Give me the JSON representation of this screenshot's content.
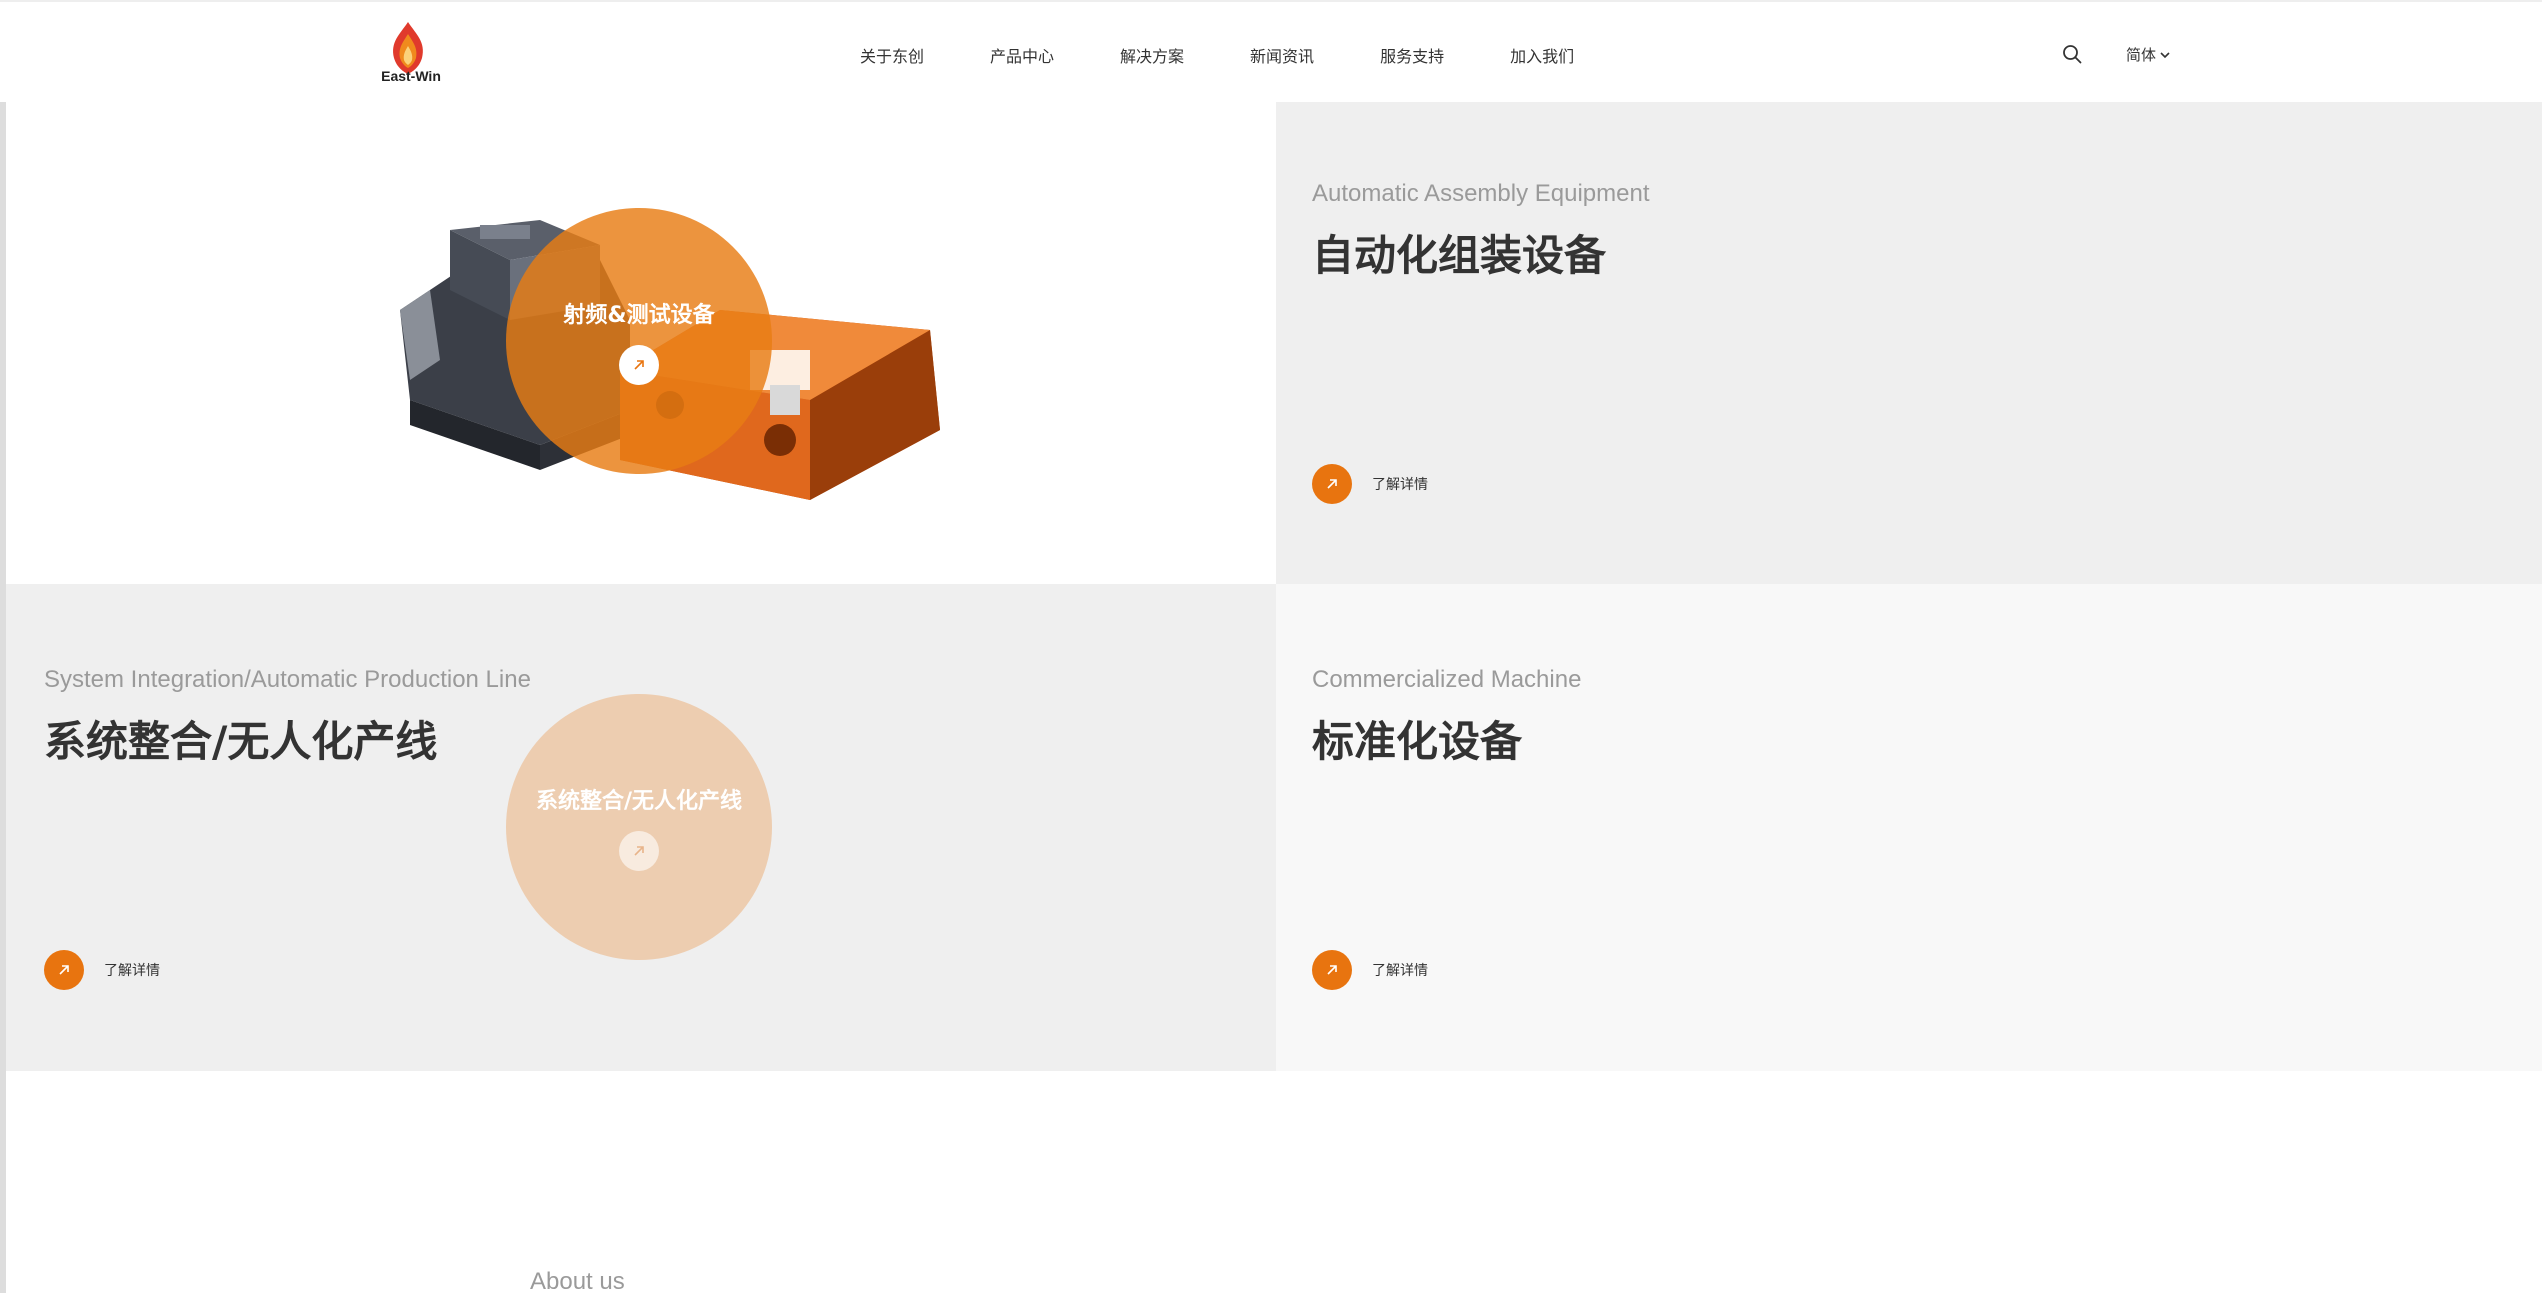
{
  "brand": {
    "logo_text": "East-Win",
    "colors": {
      "accent": "#e8740f",
      "logo_red": "#e03a2c",
      "logo_orange": "#f08a1d"
    }
  },
  "nav": {
    "items": [
      {
        "label": "关于东创"
      },
      {
        "label": "产品中心"
      },
      {
        "label": "解决方案"
      },
      {
        "label": "新闻资讯"
      },
      {
        "label": "服务支持"
      },
      {
        "label": "加入我们"
      }
    ],
    "search_icon": "search-icon",
    "language": "简体"
  },
  "panels": {
    "rf_test": {
      "overlay_title": "射频&测试设备",
      "icon": "arrow-up-right-icon"
    },
    "assembly": {
      "subtitle_en": "Automatic Assembly Equipment",
      "title_cn": "自动化组装设备",
      "more_label": "了解详情"
    },
    "integration": {
      "subtitle_en": "System Integration/Automatic Production Line",
      "title_cn": "系统整合/无人化产线",
      "more_label": "了解详情",
      "overlay_title": "系统整合/无人化产线"
    },
    "commercial": {
      "subtitle_en": "Commercialized Machine",
      "title_cn": "标准化设备",
      "more_label": "了解详情"
    }
  },
  "about": {
    "label": "About us"
  }
}
